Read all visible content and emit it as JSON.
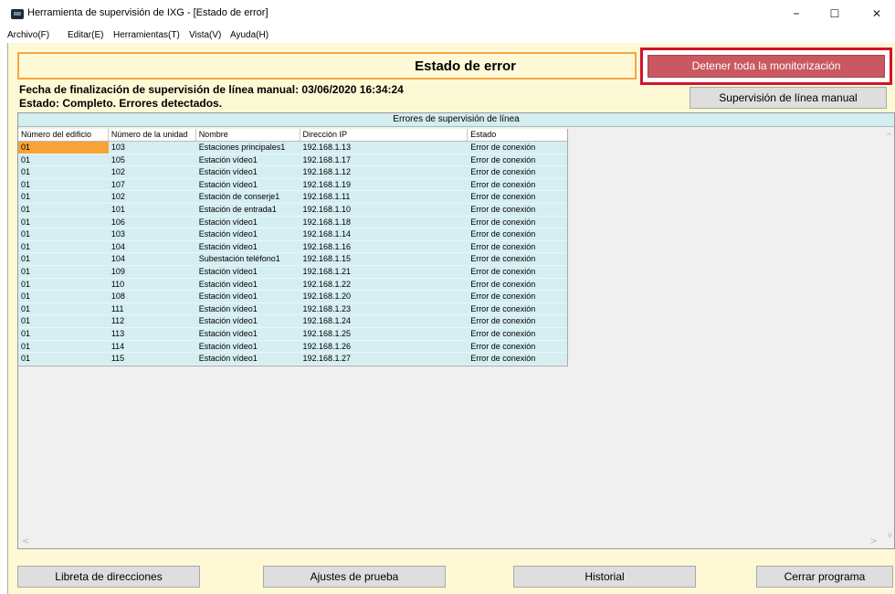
{
  "window": {
    "title": "Herramienta de supervisión de IXG - [Estado de error]",
    "minimize": "–",
    "maximize": "☐",
    "close": "✕"
  },
  "menu": [
    "Archivo(F)",
    "Editar(E)",
    "Herramientas(T)",
    "Vista(V)",
    "Ayuda(H)"
  ],
  "header": {
    "title": "Estado de error",
    "stop_button": "Detener toda la monitorización",
    "manual_button": "Supervisión de línea manual"
  },
  "info": {
    "line1": "Fecha de finalización de supervisión de línea manual: 03/06/2020 16:34:24",
    "line2": "Estado: Completo. Errores detectados."
  },
  "table": {
    "caption": "Errores de supervisión de línea",
    "columns": [
      "Número del edificio",
      "Número de la unidad",
      "Nombre",
      "Dirección IP",
      "Estado"
    ],
    "rows": [
      [
        "01",
        "103",
        "Estaciones principales1",
        "192.168.1.13",
        "Error de conexión"
      ],
      [
        "01",
        "105",
        "Estación vídeo1",
        "192.168.1.17",
        "Error de conexión"
      ],
      [
        "01",
        "102",
        "Estación vídeo1",
        "192.168.1.12",
        "Error de conexión"
      ],
      [
        "01",
        "107",
        "Estación vídeo1",
        "192.168.1.19",
        "Error de conexión"
      ],
      [
        "01",
        "102",
        "Estación de conserje1",
        "192.168.1.11",
        "Error de conexión"
      ],
      [
        "01",
        "101",
        "Estación de entrada1",
        "192.168.1.10",
        "Error de conexión"
      ],
      [
        "01",
        "106",
        "Estación vídeo1",
        "192.168.1.18",
        "Error de conexión"
      ],
      [
        "01",
        "103",
        "Estación vídeo1",
        "192.168.1.14",
        "Error de conexión"
      ],
      [
        "01",
        "104",
        "Estación vídeo1",
        "192.168.1.16",
        "Error de conexión"
      ],
      [
        "01",
        "104",
        "Subestación teléfono1",
        "192.168.1.15",
        "Error de conexión"
      ],
      [
        "01",
        "109",
        "Estación vídeo1",
        "192.168.1.21",
        "Error de conexión"
      ],
      [
        "01",
        "110",
        "Estación vídeo1",
        "192.168.1.22",
        "Error de conexión"
      ],
      [
        "01",
        "108",
        "Estación vídeo1",
        "192.168.1.20",
        "Error de conexión"
      ],
      [
        "01",
        "111",
        "Estación vídeo1",
        "192.168.1.23",
        "Error de conexión"
      ],
      [
        "01",
        "112",
        "Estación vídeo1",
        "192.168.1.24",
        "Error de conexión"
      ],
      [
        "01",
        "113",
        "Estación vídeo1",
        "192.168.1.25",
        "Error de conexión"
      ],
      [
        "01",
        "114",
        "Estación vídeo1",
        "192.168.1.26",
        "Error de conexión"
      ],
      [
        "01",
        "115",
        "Estación vídeo1",
        "192.168.1.27",
        "Error de conexión"
      ]
    ]
  },
  "bottom_buttons": [
    "Libreta de direcciones",
    "Ajustes de prueba",
    "Historial",
    "Cerrar programa"
  ],
  "scroll": {
    "up": "^",
    "down": "v",
    "left": "<",
    "right": ">"
  },
  "colors": {
    "stop_button": "#c95860",
    "highlight_border": "#d0142c",
    "header_border": "#f6a544",
    "row_bg": "#d5eef2",
    "selected_cell": "#f7a336",
    "panel_bg": "#fdf9d5"
  }
}
